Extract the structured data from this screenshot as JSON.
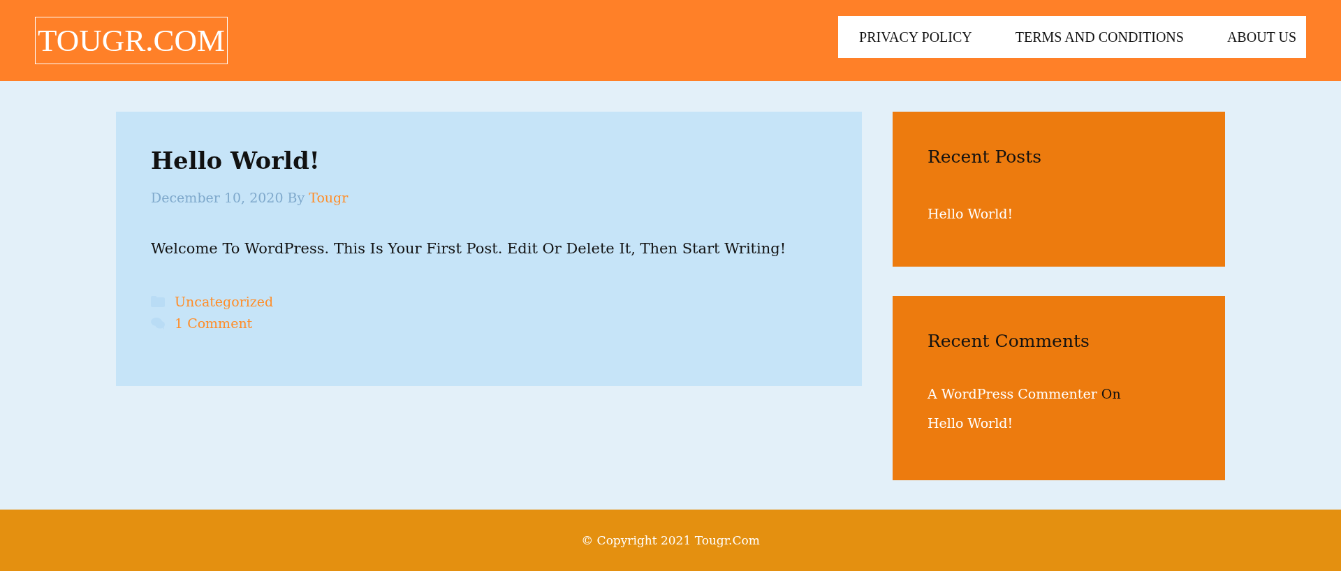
{
  "header": {
    "logo": "TOUGR.COM",
    "nav": [
      "PRIVACY POLICY",
      "TERMS AND CONDITIONS",
      "ABOUT US"
    ]
  },
  "post": {
    "title": "Hello World!",
    "date": "December 10, 2020",
    "by": "By",
    "author": "Tougr",
    "body": "Welcome To WordPress. This Is Your First Post. Edit Or Delete It, Then Start Writing!",
    "category": "Uncategorized",
    "comments": "1 Comment"
  },
  "sidebar": [
    {
      "title": "Recent Posts",
      "posts": [
        "Hello World!"
      ]
    },
    {
      "title": "Recent Comments",
      "comments": [
        {
          "author": "A WordPress Commenter",
          "on": "On",
          "post": "Hello World!"
        }
      ]
    }
  ],
  "footer": "© Copyright 2021 Tougr.Com"
}
